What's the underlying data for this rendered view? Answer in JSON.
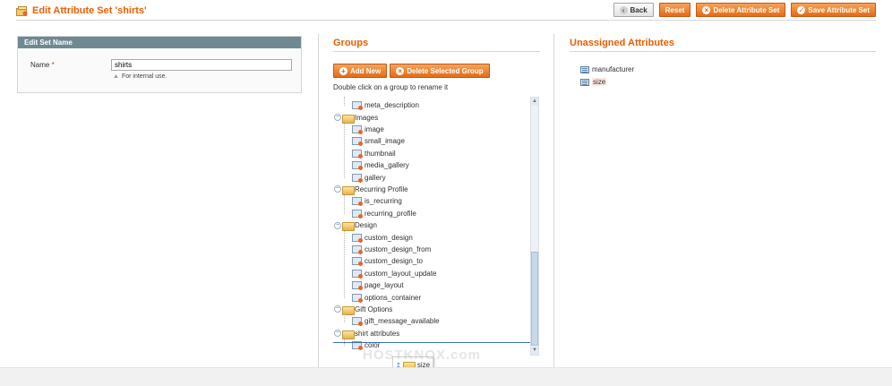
{
  "header": {
    "title": "Edit Attribute Set 'shirts'",
    "buttons": {
      "back": "Back",
      "reset": "Reset",
      "delete_set": "Delete Attribute Set",
      "save_set": "Save Attribute Set"
    }
  },
  "edit_set": {
    "section_title": "Edit Set Name",
    "name_label": "Name",
    "required_mark": "*",
    "name_value": "shirts",
    "name_hint": "For internal use."
  },
  "groups": {
    "title": "Groups",
    "add_new": "Add New",
    "delete_group": "Delete Selected Group",
    "hint": "Double click on a group to rename it",
    "tree": [
      {
        "type": "leaf",
        "label": "meta_description"
      },
      {
        "type": "group",
        "label": "Images"
      },
      {
        "type": "leaf",
        "label": "image"
      },
      {
        "type": "leaf",
        "label": "small_image"
      },
      {
        "type": "leaf",
        "label": "thumbnail"
      },
      {
        "type": "leaf",
        "label": "media_gallery"
      },
      {
        "type": "leaf",
        "label": "gallery"
      },
      {
        "type": "group",
        "label": "Recurring Profile"
      },
      {
        "type": "leaf",
        "label": "is_recurring"
      },
      {
        "type": "leaf",
        "label": "recurring_profile"
      },
      {
        "type": "group",
        "label": "Design"
      },
      {
        "type": "leaf",
        "label": "custom_design"
      },
      {
        "type": "leaf",
        "label": "custom_design_from"
      },
      {
        "type": "leaf",
        "label": "custom_design_to"
      },
      {
        "type": "leaf",
        "label": "custom_layout_update"
      },
      {
        "type": "leaf",
        "label": "page_layout"
      },
      {
        "type": "leaf",
        "label": "options_container"
      },
      {
        "type": "group",
        "label": "Gift Options"
      },
      {
        "type": "leaf",
        "label": "gift_message_available"
      },
      {
        "type": "group",
        "label": "shirt attributes"
      },
      {
        "type": "leaf",
        "label": "color"
      }
    ],
    "drag_label": "size"
  },
  "unassigned": {
    "title": "Unassigned Attributes",
    "items": [
      "manufacturer",
      "size"
    ]
  },
  "watermark": "HOSTKNOX.com",
  "colors": {
    "accent": "#eb5e00",
    "section_bar": "#6f8992",
    "button_orange": "#e66b13"
  }
}
